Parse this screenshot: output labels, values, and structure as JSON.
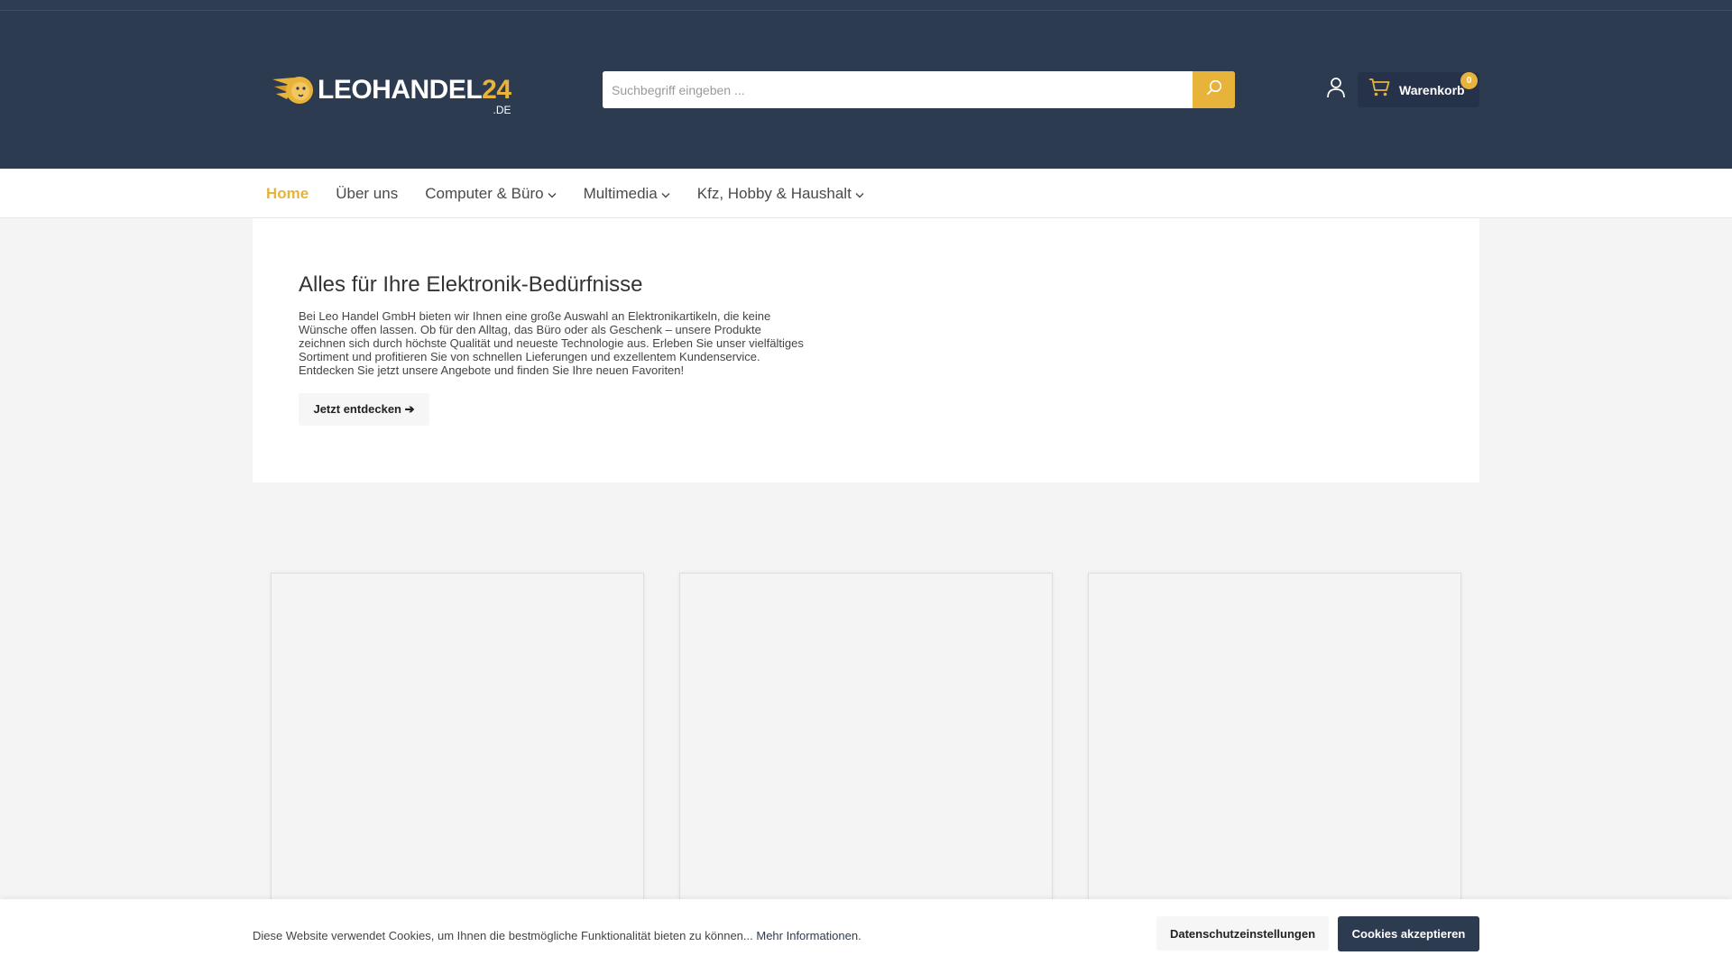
{
  "colors": {
    "header": "#2d3b51",
    "accent": "#e8b33a",
    "page_bg": "#f4f4f4"
  },
  "header": {
    "logo": {
      "word": "LEOHANDEL",
      "number": "24",
      "tld": ".DE",
      "icon": "lion-head-icon"
    },
    "search": {
      "placeholder": "Suchbegriff eingeben ...",
      "value": "",
      "icon": "search-icon"
    },
    "account_icon": "user-icon",
    "cart": {
      "label": "Warenkorb",
      "count": "0",
      "icon": "cart-icon"
    }
  },
  "nav": {
    "items": [
      {
        "label": "Home",
        "active": true
      },
      {
        "label": "Über uns"
      },
      {
        "label": "Computer & Büro",
        "dropdown": true
      },
      {
        "label": "Multimedia",
        "dropdown": true
      },
      {
        "label": "Kfz, Hobby & Haushalt",
        "dropdown": true
      }
    ]
  },
  "hero": {
    "title": "Alles für Ihre Elektronik-Bedürfnisse",
    "text": "Bei Leo Handel GmbH bieten wir Ihnen eine große Auswahl an Elektronikartikeln, die keine Wünsche offen lassen. Ob für den Alltag, das Büro oder als Geschenk – unsere Produkte zeichnen sich durch höchste Qualität und neueste Technologie aus. Erleben Sie unser vielfältiges Sortiment und profitieren Sie von schnellen Lieferungen und exzellentem Kundenservice. Entdecken Sie jetzt unsere Angebote und finden Sie Ihre neuen Favoriten!",
    "button_label": "Jetzt entdecken ➔"
  },
  "cookie": {
    "text": "Diese Website verwendet Cookies, um Ihnen die bestmögliche Funktionalität bieten zu können...",
    "link": "Mehr Informationen",
    "link_suffix": ".",
    "settings_label": "Datenschutzeinstellungen",
    "accept_label": "Cookies akzeptieren"
  }
}
